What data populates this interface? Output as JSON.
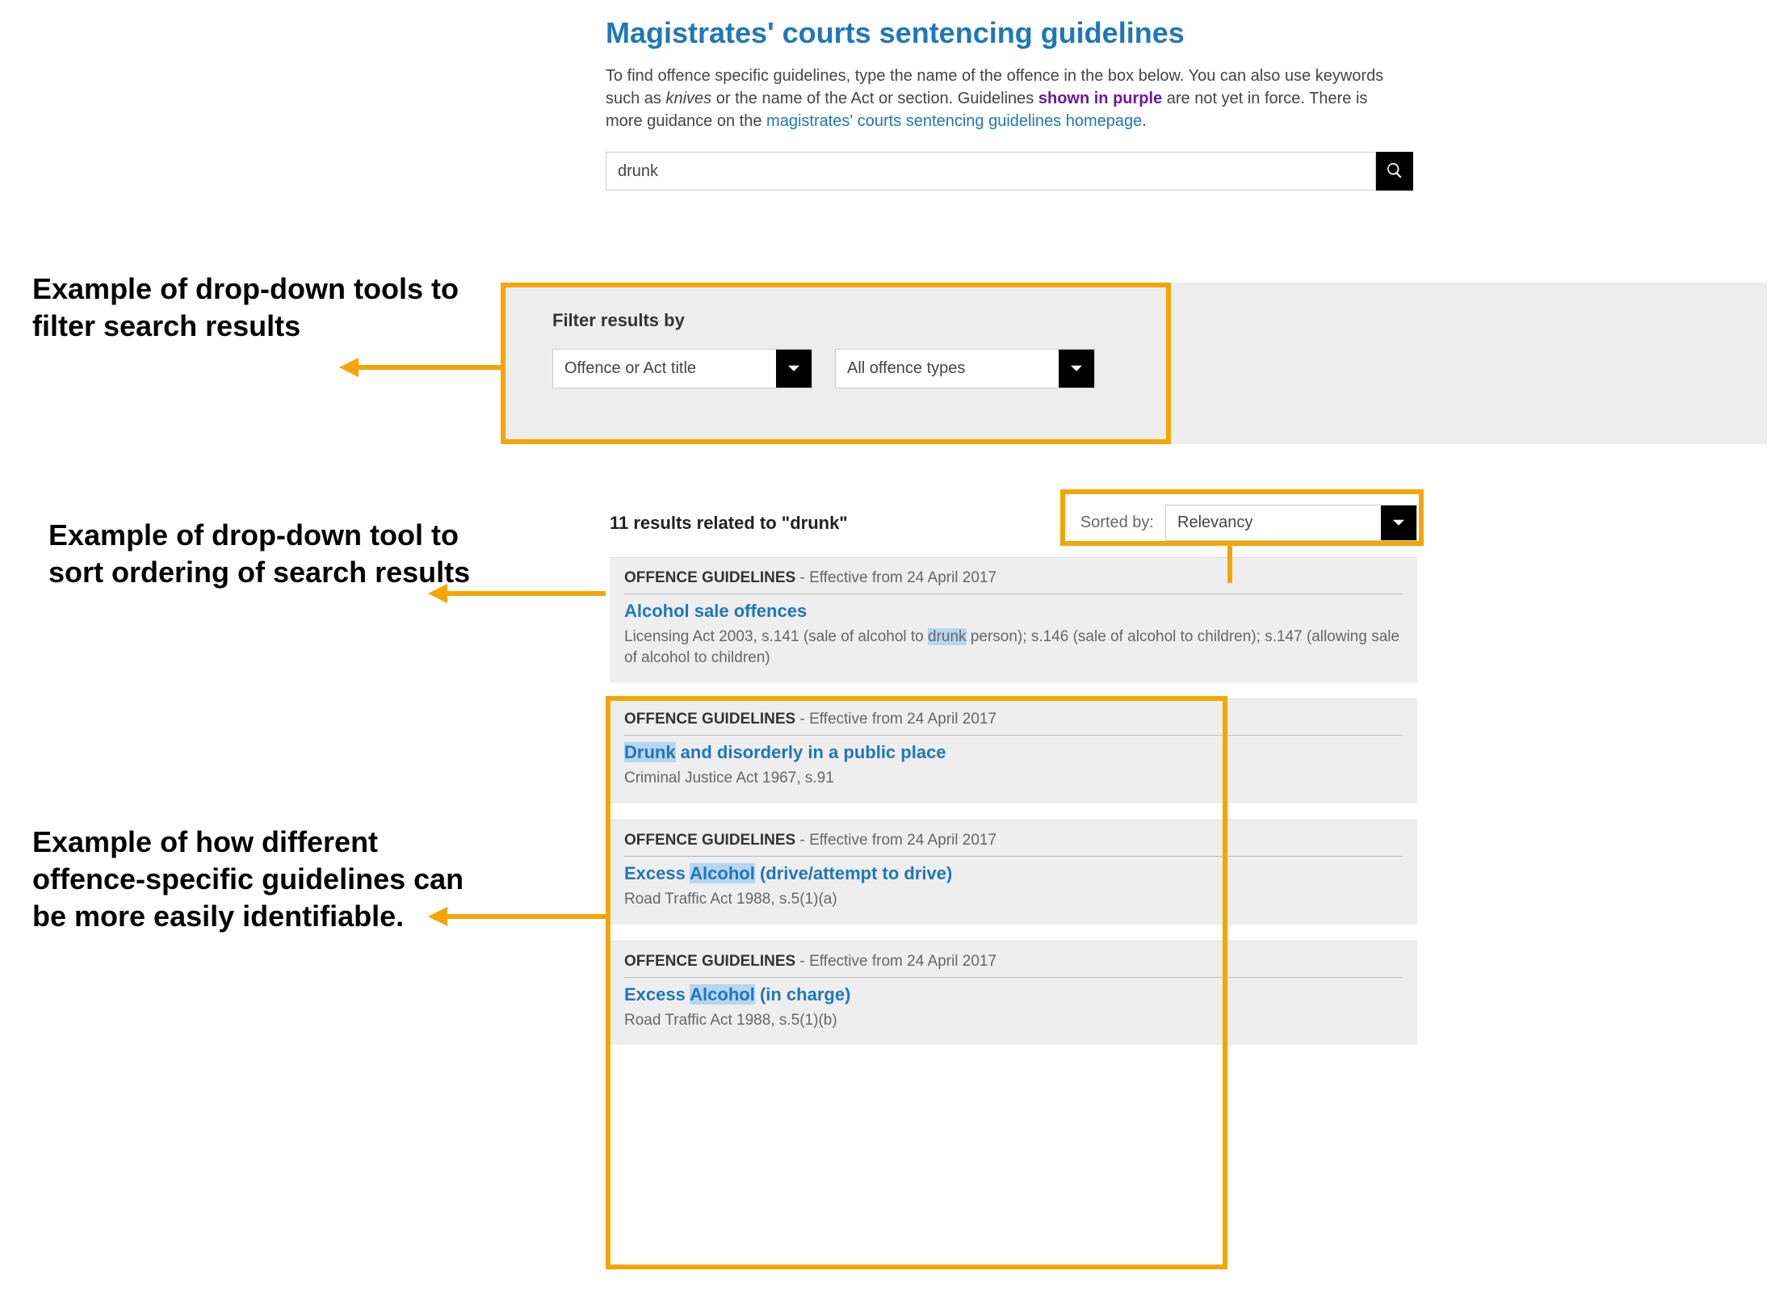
{
  "page_title": "Magistrates' courts sentencing guidelines",
  "intro": {
    "t1": "To find offence specific guidelines, type the name of the offence in the box below. You can also use keywords such as ",
    "t2": "knives",
    "t3": " or the name of the Act or section. Guidelines ",
    "t4": "shown in purple",
    "t5": " are not yet in force. There is more guidance on the ",
    "link": "magistrates' courts sentencing guidelines homepage",
    "t6": "."
  },
  "search_value": "drunk",
  "filter": {
    "title": "Filter results by",
    "dropdown1": "Offence or Act title",
    "dropdown2": "All offence types"
  },
  "results_count": "11 results related to \"drunk\"",
  "sort": {
    "label": "Sorted by:",
    "value": "Relevancy"
  },
  "cards": [
    {
      "cat": "OFFENCE GUIDELINES",
      "eff": " - Effective from 24 April 2017",
      "title_pre": "Alcohol sale offences",
      "title_hl": "",
      "title_post": "",
      "desc_pre": "Licensing Act 2003, s.141 (sale of alcohol to ",
      "desc_hl": "drunk",
      "desc_post": " person); s.146 (sale of alcohol to children); s.147 (allowing sale of alcohol to children)"
    },
    {
      "cat": "OFFENCE GUIDELINES",
      "eff": " - Effective from 24 April 2017",
      "title_pre": "",
      "title_hl": "Drunk",
      "title_post": " and disorderly in a public place",
      "desc_pre": "Criminal Justice Act 1967, s.91",
      "desc_hl": "",
      "desc_post": ""
    },
    {
      "cat": "OFFENCE GUIDELINES",
      "eff": " - Effective from 24 April 2017",
      "title_pre": "Excess ",
      "title_hl": "Alcohol",
      "title_post": " (drive/attempt to drive)",
      "desc_pre": "Road Traffic Act 1988, s.5(1)(a)",
      "desc_hl": "",
      "desc_post": ""
    },
    {
      "cat": "OFFENCE GUIDELINES",
      "eff": " - Effective from 24 April 2017",
      "title_pre": "Excess ",
      "title_hl": "Alcohol",
      "title_post": " (in charge)",
      "desc_pre": "Road Traffic Act 1988, s.5(1)(b)",
      "desc_hl": "",
      "desc_post": ""
    }
  ],
  "annotations": {
    "a1": "Example of drop-down tools to filter search results",
    "a2": "Example of drop-down tool to sort ordering of search results",
    "a3": "Example of how different offence-specific guidelines can be more easily identifiable."
  }
}
